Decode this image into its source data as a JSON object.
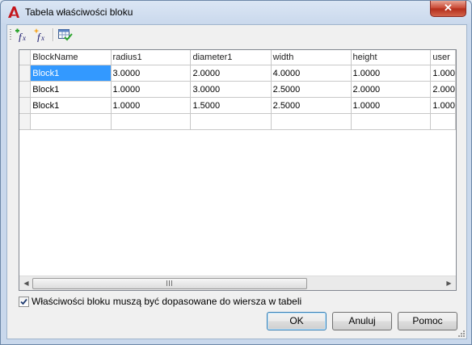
{
  "window": {
    "title": "Tabela właściwości bloku",
    "close_label": "✕"
  },
  "toolbar": {
    "buttons": [
      {
        "icon": "add-property-fx-icon"
      },
      {
        "icon": "add-user-parameter-fx-icon"
      },
      {
        "icon": "audit-table-icon"
      }
    ]
  },
  "grid": {
    "columns": [
      "BlockName",
      "radius1",
      "diameter1",
      "width",
      "height",
      "user"
    ],
    "rows": [
      [
        "Block1",
        "3.0000",
        "2.0000",
        "4.0000",
        "1.0000",
        "1.000"
      ],
      [
        "Block1",
        "1.0000",
        "3.0000",
        "2.5000",
        "2.0000",
        "2.000"
      ],
      [
        "Block1",
        "1.0000",
        "1.5000",
        "2.5000",
        "1.0000",
        "1.000"
      ],
      [
        "",
        "",
        "",
        "",
        "",
        ""
      ]
    ],
    "scroll_thumb_glyph": "III",
    "scroll_left": "◀",
    "scroll_right": "▶"
  },
  "options": {
    "must_match_label": "Właściwości bloku muszą być dopasowane do wiersza w tabeli",
    "must_match_checked": true
  },
  "buttons": {
    "ok": "OK",
    "cancel": "Anuluj",
    "help": "Pomoc"
  }
}
